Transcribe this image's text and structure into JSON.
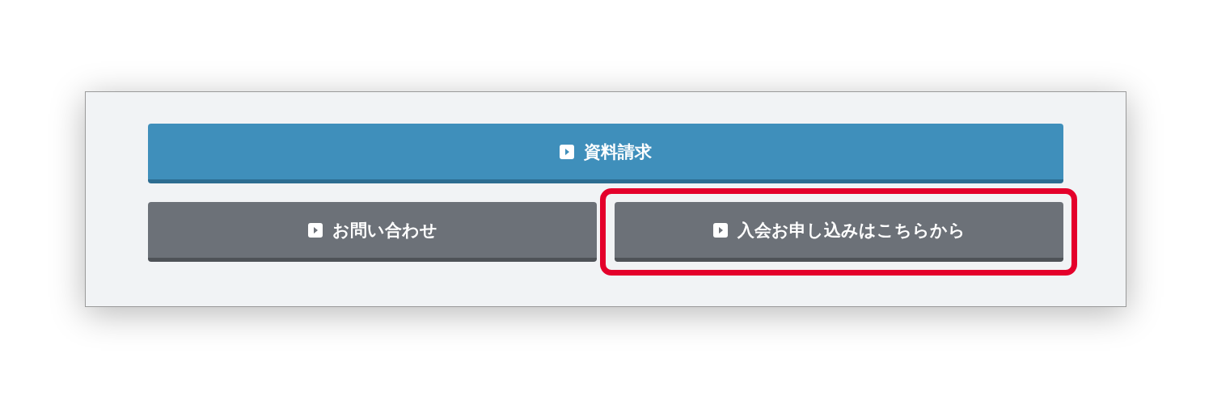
{
  "buttons": [
    {
      "label": "資料請求",
      "kind": "primary",
      "highlighted": false
    },
    {
      "label": "お問い合わせ",
      "kind": "secondary",
      "highlighted": false
    },
    {
      "label": "入会お申し込みはこちらから",
      "kind": "secondary",
      "highlighted": true
    }
  ]
}
